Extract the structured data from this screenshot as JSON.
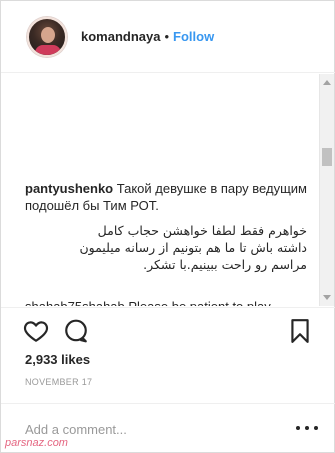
{
  "post": {
    "author": "komandnaya",
    "separator": "•",
    "follow_label": "Follow"
  },
  "comments": {
    "main": {
      "user": "pantyushenko",
      "text": "Такой девушке в пару ведущим подошёл бы Тим РОТ."
    },
    "persian_reply": "خواهرم فقط لطفا خواهشن حجاب کامل داشته باش تا ما هم بتونیم از رسانه میلیمون مراسم رو راحت ببینیم.با تشکر.",
    "next_preview": "shahab75shahab Please be patient to play"
  },
  "actions": {
    "likes": "2,933 likes",
    "date": "NOVEMBER 17"
  },
  "add_comment": {
    "placeholder": "Add a comment..."
  },
  "watermark": "parsnaz.com",
  "colors": {
    "follow_blue": "#3897f0",
    "text": "#262626",
    "muted": "#999999",
    "border": "#dbdbdb"
  },
  "icons": [
    "heart-icon",
    "comment-icon",
    "bookmark-icon",
    "more-options-icon"
  ]
}
